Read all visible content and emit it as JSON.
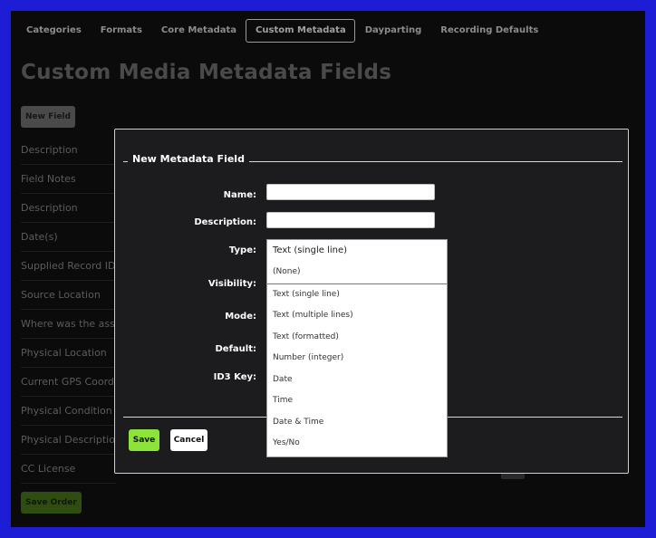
{
  "tabs": [
    "Categories",
    "Formats",
    "Core Metadata",
    "Custom Metadata",
    "Dayparting",
    "Recording Defaults"
  ],
  "active_tab": "Custom Metadata",
  "page_title": "Custom Media Metadata Fields",
  "new_field_button": "New Field",
  "field_list": [
    "Description",
    "Field Notes",
    "Description",
    "Date(s)",
    "Supplied Record ID",
    "Source Location",
    "Where was the asset",
    "Physical Location",
    "Current GPS Coordinates",
    "Physical Condition",
    "Physical Description",
    "CC License"
  ],
  "save_order_button": "Save Order",
  "modal": {
    "legend": "New Metadata Field",
    "labels": {
      "name": "Name:",
      "description": "Description:",
      "type": "Type:",
      "visibility": "Visibility:",
      "mode": "Mode:",
      "default": "Default:",
      "id3_key": "ID3 Key:"
    },
    "name_value": "",
    "description_value": "",
    "save_button": "Save",
    "cancel_button": "Cancel"
  },
  "type_dropdown": {
    "selected": "Text (single line)",
    "options": [
      "(None)",
      "Text (single line)",
      "Text (multiple lines)",
      "Text (formatted)",
      "Number (integer)",
      "Date",
      "Time",
      "Date & Time",
      "Yes/No"
    ]
  }
}
